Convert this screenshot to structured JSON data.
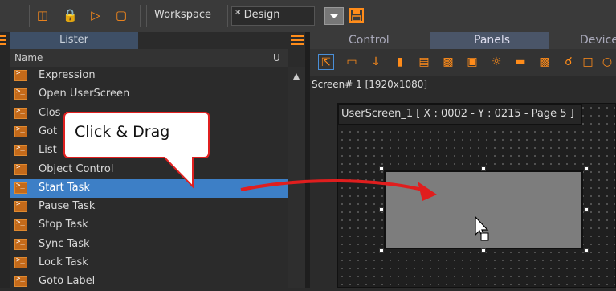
{
  "toolbar": {
    "workspace_label": "Workspace",
    "design_tab_label": "* Design"
  },
  "lister": {
    "title": "Lister",
    "col_name": "Name",
    "col_u": "U",
    "items": [
      {
        "label": "Expression"
      },
      {
        "label": "Open UserScreen"
      },
      {
        "label": "Clos"
      },
      {
        "label": "Got"
      },
      {
        "label": "List"
      },
      {
        "label": "Object Control"
      },
      {
        "label": "Start Task",
        "selected": true
      },
      {
        "label": "Pause Task"
      },
      {
        "label": "Stop Task"
      },
      {
        "label": "Sync Task"
      },
      {
        "label": "Lock Task"
      },
      {
        "label": "Goto Label"
      }
    ]
  },
  "right_tabs": {
    "control": "Control",
    "panels": "Panels",
    "device": "Device"
  },
  "screen_label": "Screen# 1 [1920x1080]",
  "userscreen_label": "UserScreen_1 [ X : 0002 - Y : 0215 - Page 5 ]",
  "callout": {
    "text": "Click & Drag"
  },
  "colors": {
    "accent": "#ff8c1a",
    "selection": "#3d7fc6",
    "arrow": "#e01e1e",
    "callout_border": "#e02020"
  }
}
